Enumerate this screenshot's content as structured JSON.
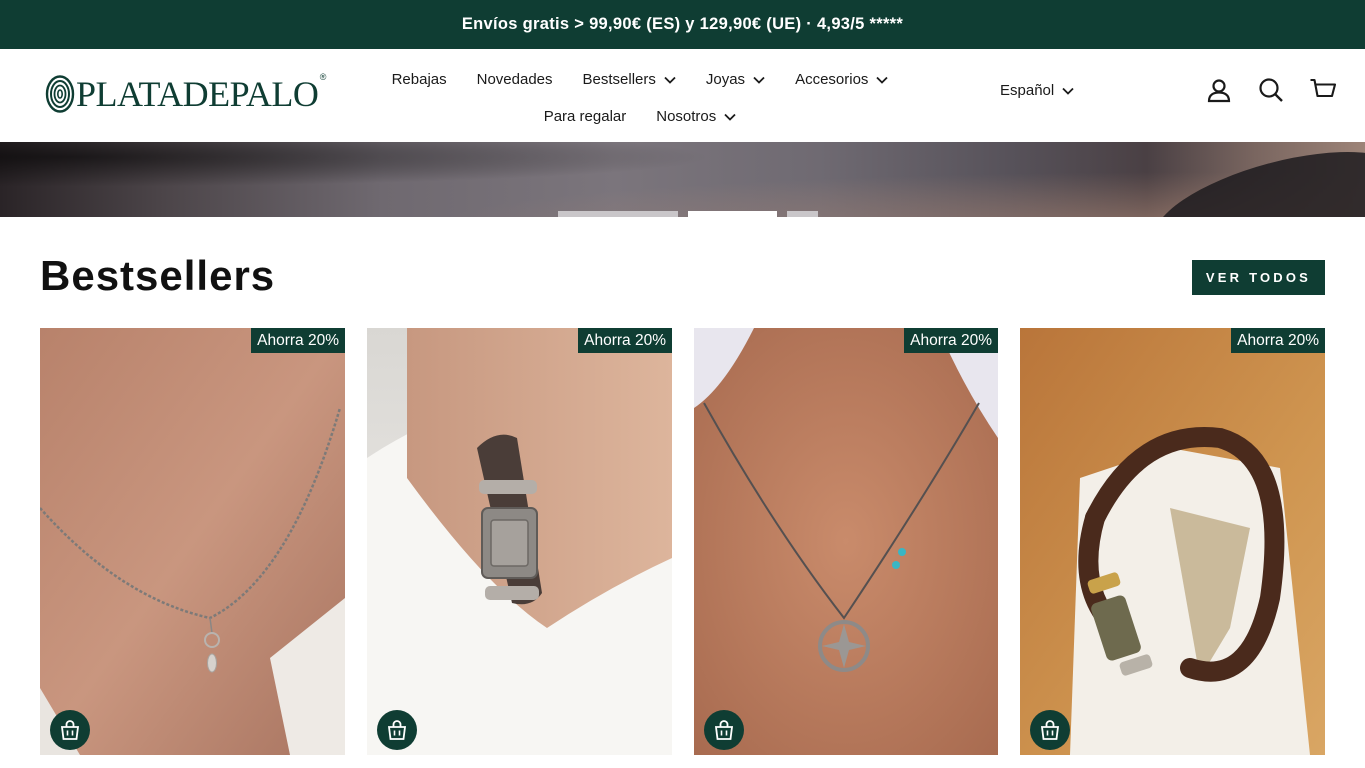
{
  "announcement": "Envíos gratis > 99,90€ (ES) y 129,90€ (UE) · 4,93/5 *****",
  "brand": {
    "logo_text": "PLATADEPALO",
    "reg_mark": "®"
  },
  "nav": {
    "row1": [
      {
        "label": "Rebajas",
        "dropdown": false
      },
      {
        "label": "Novedades",
        "dropdown": false
      },
      {
        "label": "Bestsellers",
        "dropdown": true
      },
      {
        "label": "Joyas",
        "dropdown": true
      },
      {
        "label": "Accesorios",
        "dropdown": true
      }
    ],
    "row2": [
      {
        "label": "Para regalar",
        "dropdown": false
      },
      {
        "label": "Nosotros",
        "dropdown": true
      }
    ]
  },
  "language": {
    "selected": "Español"
  },
  "header_icons": [
    "account-icon",
    "search-icon",
    "cart-icon"
  ],
  "hero": {
    "slides": 3,
    "active_slide": 2
  },
  "bestsellers": {
    "title": "Bestsellers",
    "view_all_label": "VER TODOS",
    "products": [
      {
        "badge": "Ahorra 20%",
        "image": "beaded-necklace-on-neck"
      },
      {
        "badge": "Ahorra 20%",
        "image": "leather-bracelet-on-wrist"
      },
      {
        "badge": "Ahorra 20%",
        "image": "compass-pendant-necklace"
      },
      {
        "badge": "Ahorra 20%",
        "image": "brown-cord-bracelet"
      }
    ]
  },
  "colors": {
    "brand_green": "#0f3d33",
    "text": "#1a1a1a",
    "background": "#ffffff"
  }
}
